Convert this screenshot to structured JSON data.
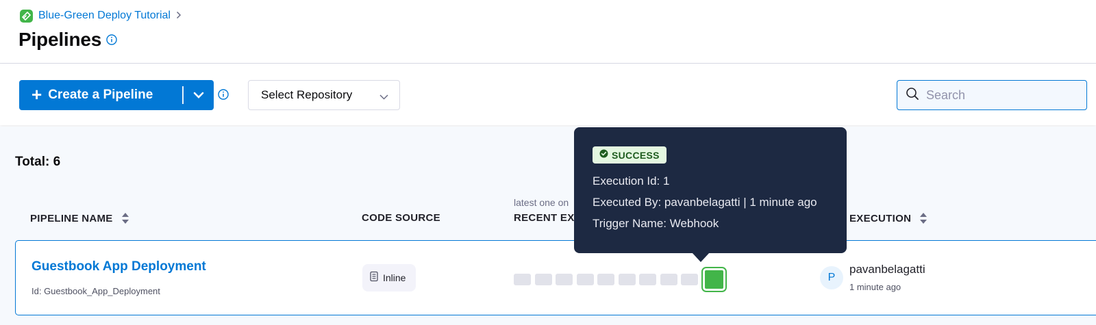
{
  "breadcrumb": {
    "project": "Blue-Green Deploy Tutorial"
  },
  "page": {
    "title": "Pipelines"
  },
  "toolbar": {
    "create_label": "Create a Pipeline",
    "repo_label": "Select Repository",
    "search_placeholder": "Search"
  },
  "list": {
    "total": "Total: 6",
    "recent_sublabel": "latest one on",
    "columns": {
      "name": "PIPELINE NAME",
      "code_source": "CODE SOURCE",
      "recent": "RECENT EX",
      "execution": "EXECUTION"
    },
    "rows": [
      {
        "name": "Guestbook App Deployment",
        "id": "Id: Guestbook_App_Deployment",
        "code_source": "Inline",
        "avatar_initial": "P",
        "executed_by": "pavanbelagatti",
        "executed_time": "1 minute ago"
      }
    ]
  },
  "tooltip": {
    "status": "SUCCESS",
    "execution_id": "Execution Id: 1",
    "executed_by": "Executed By: pavanbelagatti | 1 minute ago",
    "trigger": "Trigger Name: Webhook"
  },
  "colors": {
    "primary": "#0278d5",
    "success": "#42b549",
    "tooltip_bg": "#1d2942"
  }
}
